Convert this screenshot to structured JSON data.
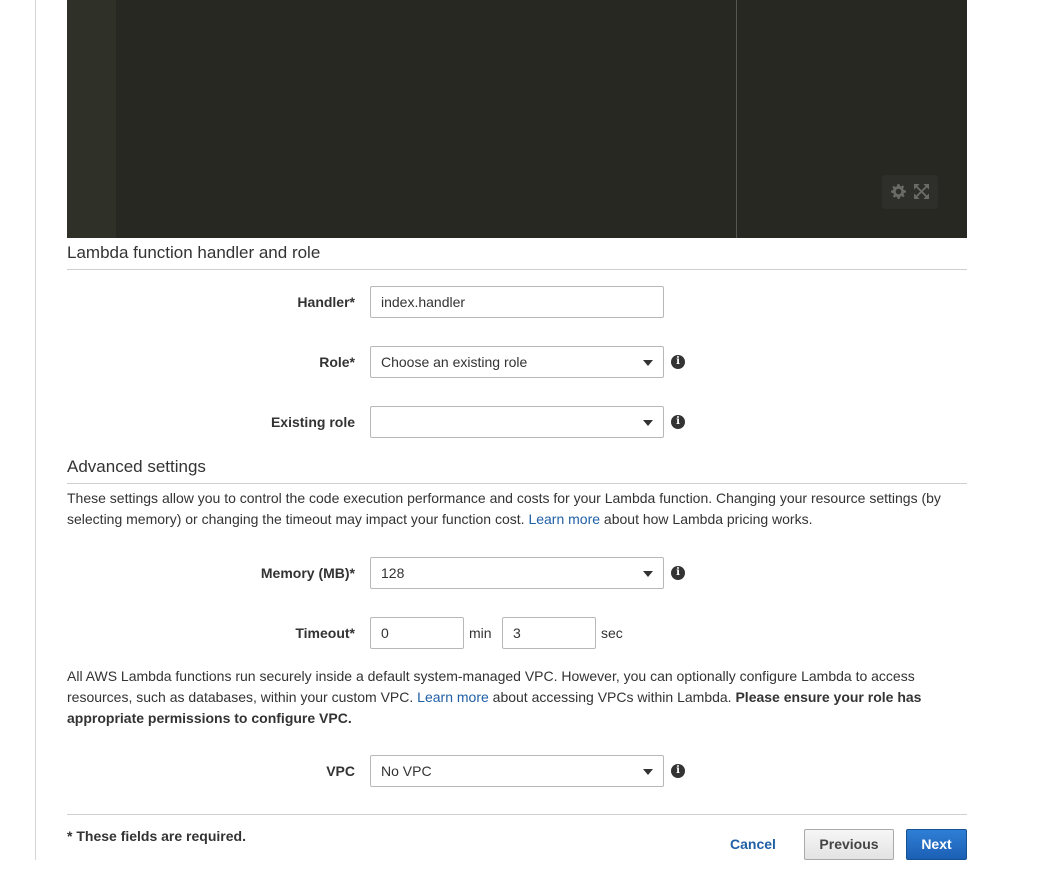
{
  "colors": {
    "link": "#1f5fa5",
    "primary_button": "#2066bd",
    "editor_bg": "#272822"
  },
  "editor": {
    "settings_icon": "gear-icon",
    "fullscreen_icon": "expand-icon"
  },
  "handler_section": {
    "title": "Lambda function handler and role",
    "handler": {
      "label": "Handler*",
      "value": "index.handler"
    },
    "role": {
      "label": "Role*",
      "value": "Choose an existing role"
    },
    "existing_role": {
      "label": "Existing role",
      "value": ""
    }
  },
  "advanced_section": {
    "title": "Advanced settings",
    "description": {
      "part1": "These settings allow you to control the code execution performance and costs for your Lambda function. Changing your resource settings (by selecting memory) or changing the timeout may impact your function cost. ",
      "link": "Learn more",
      "part2": " about how Lambda pricing works."
    },
    "memory": {
      "label": "Memory (MB)*",
      "value": "128"
    },
    "timeout": {
      "label": "Timeout*",
      "min_value": "0",
      "min_unit": "min",
      "sec_value": "3",
      "sec_unit": "sec"
    },
    "vpc_description": {
      "part1": "All AWS Lambda functions run securely inside a default system-managed VPC. However, you can optionally configure Lambda to access resources, such as databases, within your custom VPC. ",
      "link": "Learn more",
      "part2": " about accessing VPCs within Lambda. ",
      "bold": "Please ensure your role has appropriate permissions to configure VPC."
    },
    "vpc": {
      "label": "VPC",
      "value": "No VPC"
    }
  },
  "footer": {
    "required_note": "* These fields are required.",
    "cancel_label": "Cancel",
    "previous_label": "Previous",
    "next_label": "Next"
  }
}
